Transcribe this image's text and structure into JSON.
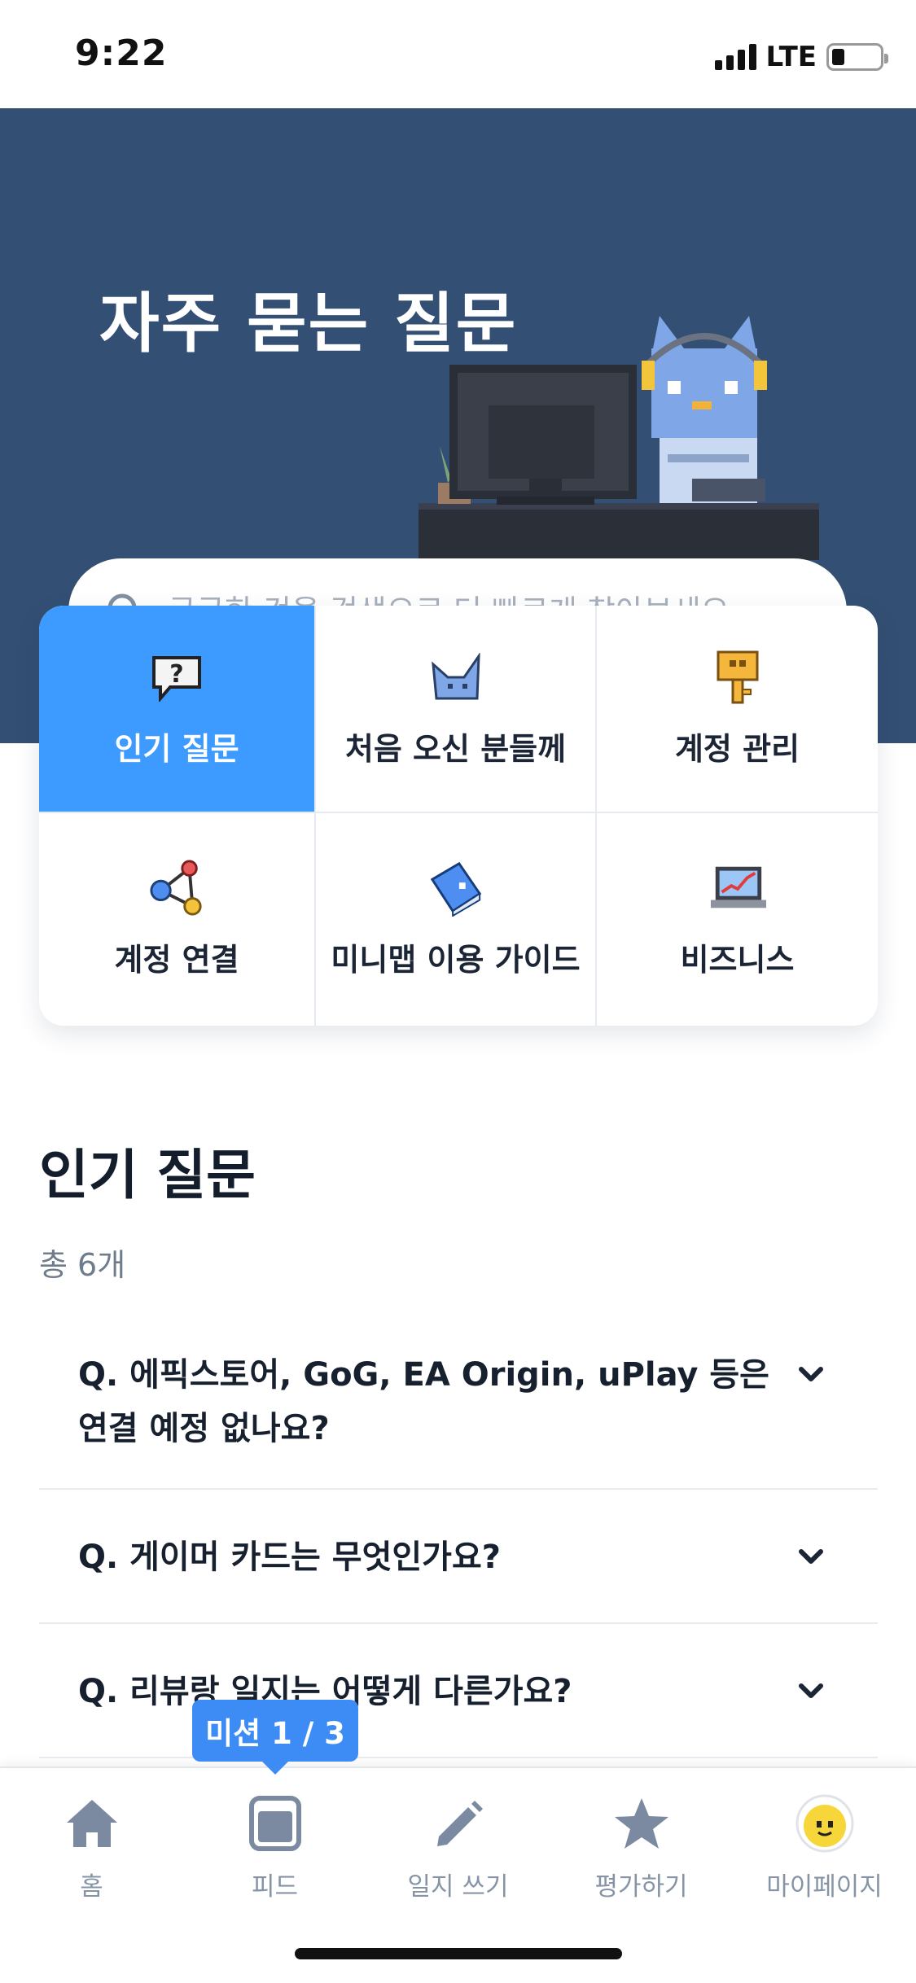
{
  "status_bar": {
    "time": "9:22",
    "network": "LTE"
  },
  "hero": {
    "title": "자주 묻는 질문",
    "search_placeholder": "궁금한 것을 검색으로 더 빠르게 찾아보세요."
  },
  "categories": [
    {
      "label": "인기 질문",
      "icon": "question-bubble-icon",
      "active": true
    },
    {
      "label": "처음 오신 분들께",
      "icon": "cat-face-icon",
      "active": false
    },
    {
      "label": "계정 관리",
      "icon": "key-icon",
      "active": false
    },
    {
      "label": "계정 연결",
      "icon": "connection-nodes-icon",
      "active": false
    },
    {
      "label": "미니맵 이용 가이드",
      "icon": "book-icon",
      "active": false
    },
    {
      "label": "비즈니스",
      "icon": "laptop-chart-icon",
      "active": false
    }
  ],
  "section": {
    "title": "인기 질문",
    "count": "총 6개"
  },
  "faqs": [
    {
      "question": "Q. 에픽스토어, GoG, EA Origin, uPlay 등은 연결 예정 없나요?"
    },
    {
      "question": "Q. 게이머 카드는 무엇인가요?"
    },
    {
      "question": "Q. 리뷰랑 일지는 어떻게 다른가요?"
    }
  ],
  "mission_badge": "미션 1 / 3",
  "bottom_nav": [
    {
      "label": "홈",
      "icon": "home-icon"
    },
    {
      "label": "피드",
      "icon": "feed-icon"
    },
    {
      "label": "일지 쓰기",
      "icon": "pencil-icon"
    },
    {
      "label": "평가하기",
      "icon": "star-icon"
    },
    {
      "label": "마이페이지",
      "icon": "avatar-icon"
    }
  ],
  "colors": {
    "hero_bg": "#334f73",
    "accent": "#3d9bff",
    "mission": "#3d8bf5"
  }
}
